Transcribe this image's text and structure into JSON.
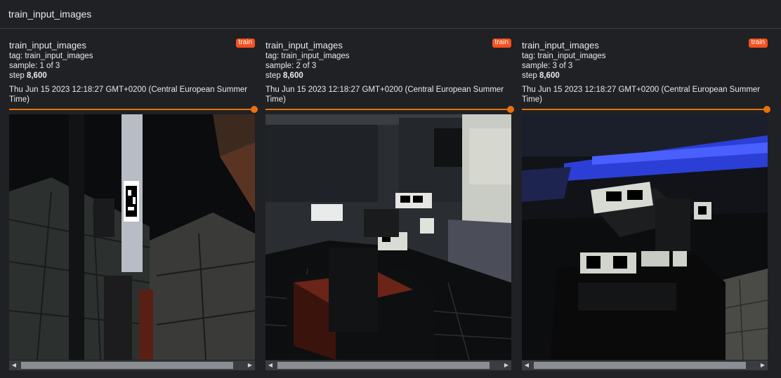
{
  "header": {
    "title": "train_input_images"
  },
  "accent_color": "#e8710a",
  "badge_color": "#f4511e",
  "cards": [
    {
      "title": "train_input_images",
      "badge": "train",
      "tag_label": "tag: train_input_images",
      "sample_label": "sample: 1 of 3",
      "step_prefix": "step",
      "step_value": "8,600",
      "timestamp": "Thu Jun 15 2023 12:18:27 GMT+0200 (Central European Summer Time)"
    },
    {
      "title": "train_input_images",
      "badge": "train",
      "tag_label": "tag: train_input_images",
      "sample_label": "sample: 2 of 3",
      "step_prefix": "step",
      "step_value": "8,600",
      "timestamp": "Thu Jun 15 2023 12:18:27 GMT+0200 (Central European Summer Time)"
    },
    {
      "title": "train_input_images",
      "badge": "train",
      "tag_label": "tag: train_input_images",
      "sample_label": "sample: 3 of 3",
      "step_prefix": "step",
      "step_value": "8,600",
      "timestamp": "Thu Jun 15 2023 12:18:27 GMT+0200 (Central European Summer Time)"
    }
  ],
  "step_slider_fraction": 1.0,
  "icons": {
    "scroll_left": "left-arrow-icon",
    "scroll_right": "right-arrow-icon"
  }
}
